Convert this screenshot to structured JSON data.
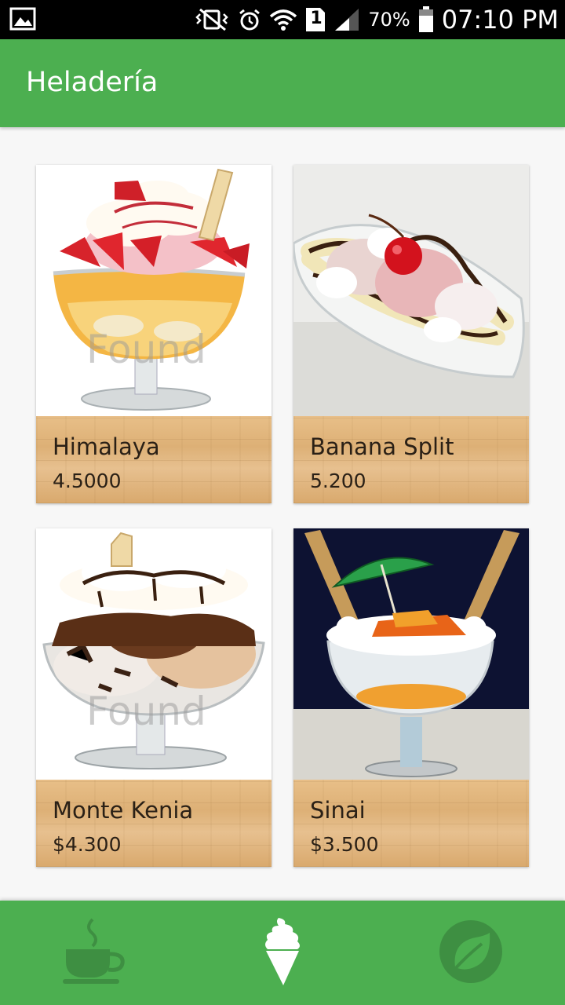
{
  "status_bar": {
    "battery": "70%",
    "time": "07:10 PM",
    "sim_slot": "1",
    "icons": [
      "image-icon",
      "vibrate-icon",
      "alarm-icon",
      "wifi-icon",
      "sim-icon",
      "signal-icon",
      "battery-icon"
    ]
  },
  "app_bar": {
    "title": "Heladería"
  },
  "products": [
    {
      "name": "Himalaya",
      "price": "4.5000",
      "watermark": "Found"
    },
    {
      "name": "Banana Split",
      "price": "5.200"
    },
    {
      "name": "Monte Kenia",
      "price": "$4.300",
      "watermark": "Found"
    },
    {
      "name": "Sinai",
      "price": "$3.500"
    }
  ],
  "bottom_nav": {
    "items": [
      "coffee-icon",
      "ice-cream-icon",
      "leaf-icon"
    ],
    "selected": "ice-cream-icon"
  },
  "colors": {
    "primary": "#4caf50",
    "status_bar": "#000000",
    "card_footer_wood": "#ddb076",
    "nav_icon_inactive": "#3e8f42",
    "nav_icon_active": "#ffffff"
  }
}
